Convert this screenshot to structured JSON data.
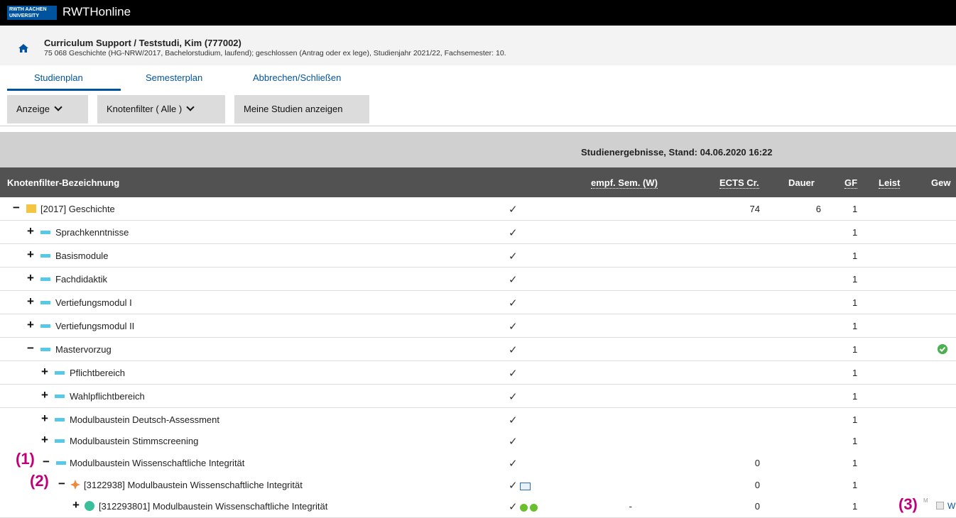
{
  "app": {
    "logo_lines": [
      "RWTH AACHEN",
      "UNIVERSITY"
    ],
    "name": "RWTHonline"
  },
  "context": {
    "title": "Curriculum Support  / Teststudi, Kim (777002)",
    "subtitle": "75 068 Geschichte (HG-NRW/2017, Bachelorstudium, laufend); geschlossen (Antrag oder ex lege), Studienjahr 2021/22, Fachsemester: 10."
  },
  "tabs": [
    {
      "label": "Studienplan"
    },
    {
      "label": "Semesterplan"
    },
    {
      "label": "Abbrechen/Schließen"
    }
  ],
  "toolbar": {
    "anzeige": "Anzeige",
    "knotenfilter": "Knotenfilter ( Alle )",
    "meine": "Meine Studien anzeigen"
  },
  "table": {
    "band_title": "Studienergebnisse, Stand: 04.06.2020 16:22",
    "headers": {
      "name": "Knotenfilter-Bezeichnung",
      "empf": "empf. Sem. (W)",
      "ects": "ECTS Cr.",
      "dauer": "Dauer",
      "gf": "GF",
      "leist": "Leist",
      "gew": "Gew"
    },
    "rows": [
      {
        "toggle": "−",
        "label": "[2017] Geschichte",
        "check": "✓",
        "ects": "74",
        "dauer": "6",
        "gf": "1"
      },
      {
        "toggle": "+",
        "label": "Sprachkenntnisse",
        "check": "✓",
        "gf": "1"
      },
      {
        "toggle": "+",
        "label": "Basismodule",
        "check": "✓",
        "gf": "1"
      },
      {
        "toggle": "+",
        "label": "Fachdidaktik",
        "check": "✓",
        "gf": "1"
      },
      {
        "toggle": "+",
        "label": "Vertiefungsmodul I",
        "check": "✓",
        "gf": "1"
      },
      {
        "toggle": "+",
        "label": "Vertiefungsmodul II",
        "check": "✓",
        "gf": "1"
      },
      {
        "toggle": "−",
        "label": "Mastervorzug",
        "check": "✓",
        "gf": "1"
      },
      {
        "toggle": "+",
        "label": "Pflichtbereich",
        "check": "✓",
        "gf": "1"
      },
      {
        "toggle": "+",
        "label": "Wahlpflichtbereich",
        "check": "✓",
        "gf": "1"
      },
      {
        "toggle": "+",
        "label": "Modulbaustein Deutsch-Assessment",
        "check": "✓",
        "gf": "1"
      },
      {
        "toggle": "+",
        "label": "Modulbaustein Stimmscreening",
        "check": "✓",
        "gf": "1"
      },
      {
        "toggle": "−",
        "label": "Modulbaustein Wissenschaftliche Integrität",
        "check": "✓",
        "ects": "0",
        "gf": "1",
        "annotation": "(1)"
      },
      {
        "toggle": "−",
        "label": "[3122938] Modulbaustein Wissenschaftliche Integrität",
        "check": "✓",
        "ects": "0",
        "gf": "1",
        "annotation": "(2)"
      },
      {
        "toggle": "+",
        "label": "[312293801] Modulbaustein Wissenschaftliche Integrität",
        "check": "✓",
        "empf": "-",
        "ects": "0",
        "gf": "1",
        "annotation": "(3)",
        "extra_m": "M",
        "extra_w": "W"
      }
    ]
  },
  "colors": {
    "brand_blue": "#00549f",
    "header_dark": "#525252",
    "band_gray": "#d0d0d0",
    "node_yellow": "#f5c542",
    "node_cyan": "#56c8e8",
    "node_orange": "#f0883a",
    "node_teal": "#3bbf9b",
    "annotation": "#c0007a"
  }
}
